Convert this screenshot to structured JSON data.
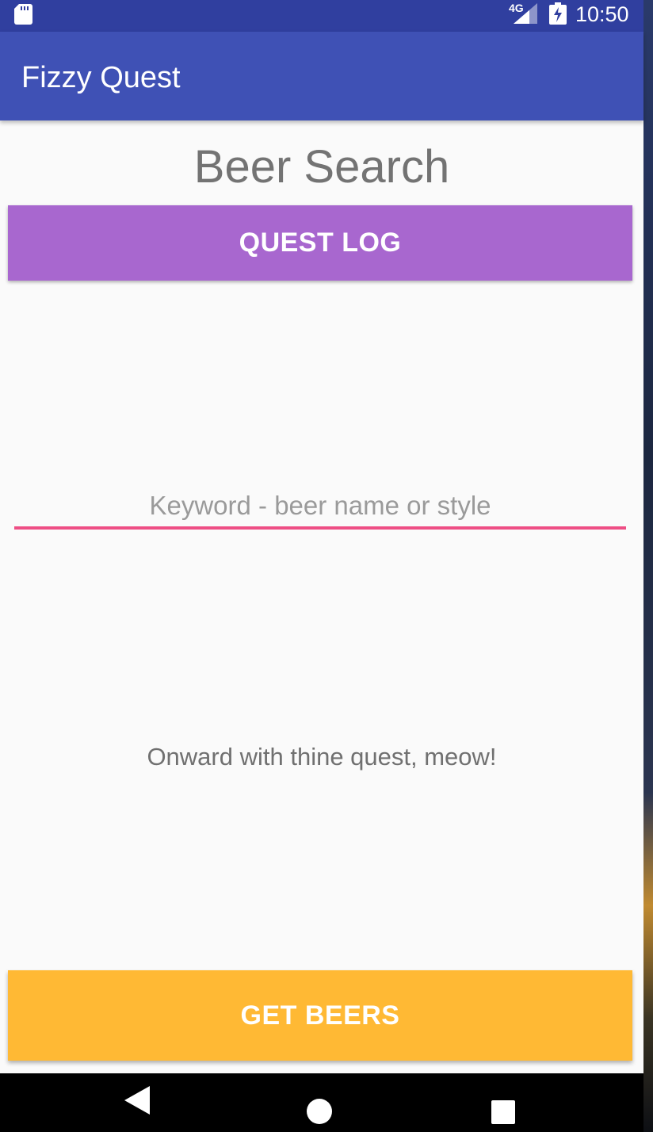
{
  "status_bar": {
    "network": "4G",
    "time": "10:50",
    "icons": [
      "sd-card-icon",
      "signal-icon",
      "battery-charging-icon"
    ]
  },
  "app_bar": {
    "title": "Fizzy Quest"
  },
  "main": {
    "heading": "Beer Search",
    "quest_log_label": "QUEST LOG",
    "keyword_input": {
      "value": "",
      "placeholder": "Keyword - beer name or style"
    },
    "status_message": "Onward with thine quest, meow!",
    "get_beers_label": "GET BEERS"
  },
  "nav_bar": {
    "icons": [
      "back-icon",
      "home-icon",
      "recents-icon"
    ]
  },
  "colors": {
    "status_bar": "#303f9f",
    "app_bar": "#3f51b5",
    "quest_log_button": "#a867cf",
    "input_underline": "#ee4e85",
    "get_beers_button": "#ffb934"
  }
}
